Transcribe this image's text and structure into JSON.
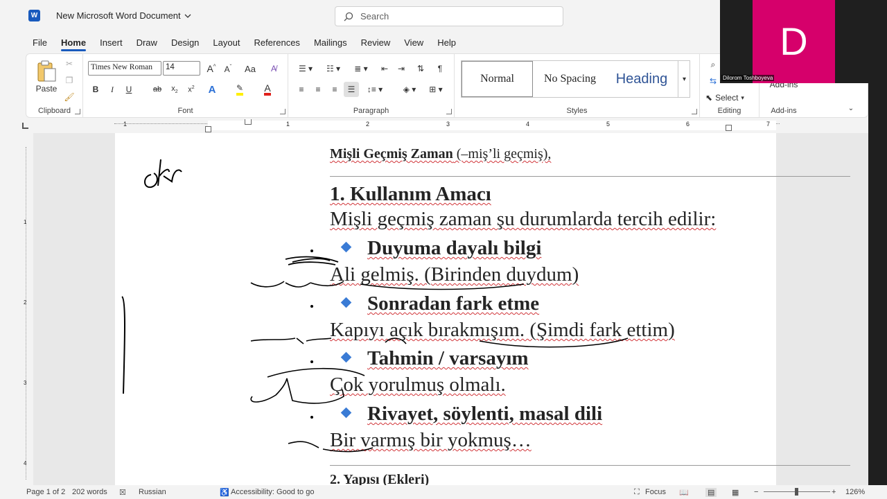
{
  "titlebar": {
    "logo": "W",
    "doc_title": "New Microsoft Word Document",
    "search_placeholder": "Search"
  },
  "menu": [
    "File",
    "Home",
    "Insert",
    "Draw",
    "Design",
    "Layout",
    "References",
    "Mailings",
    "Review",
    "View",
    "Help"
  ],
  "ribbon": {
    "clipboard": {
      "paste": "Paste",
      "label": "Clipboard"
    },
    "font": {
      "family": "Times New Roman",
      "size": "14",
      "label": "Font",
      "case": "Aa"
    },
    "paragraph": {
      "label": "Paragraph"
    },
    "styles": {
      "normal": "Normal",
      "no_spacing": "No Spacing",
      "heading": "Heading",
      "label": "Styles"
    },
    "editing": {
      "select": "Select",
      "label": "Editing"
    },
    "addins": {
      "addins": "Add-ins",
      "label": "Add-ins"
    }
  },
  "ruler": {
    "numbers": [
      "1",
      "1",
      "2",
      "3",
      "4",
      "5",
      "6",
      "7"
    ]
  },
  "vruler": {
    "numbers": [
      "1",
      "2",
      "3",
      "4"
    ]
  },
  "document": {
    "top_title_bold": "Mişli Geçmiş Zaman",
    "top_title_rest": " (–miş’li geçmiş),",
    "h1": "1. Kullanım Amacı",
    "intro": "Mişli geçmiş zaman şu durumlarda tercih edilir:",
    "items": [
      {
        "head": "Duyuma dayalı bilgi",
        "example": "Ali gelmiş. (Birinden duydum)"
      },
      {
        "head": "Sonradan fark etme",
        "example": "Kapıyı açık bırakmışım. (Şimdi fark ettim)"
      },
      {
        "head": "Tahmin / varsayım",
        "example": "Çok yorulmuş olmalı."
      },
      {
        "head": "Rivayet, söylenti, masal dili",
        "example": "Bir varmış bir yokmuş…"
      }
    ],
    "h2": "2. Yapısı (Ekleri)"
  },
  "status": {
    "page": "Page 1 of 2",
    "words": "202 words",
    "language": "Russian",
    "accessibility": "Accessibility: Good to go",
    "focus": "Focus",
    "zoom": "126%"
  },
  "video": {
    "initial": "D",
    "name": "Dilorom Toshboyeva"
  },
  "colors": {
    "word_blue": "#185abd",
    "avatar": "#d6006b",
    "diamond": "#3a7bd5"
  }
}
